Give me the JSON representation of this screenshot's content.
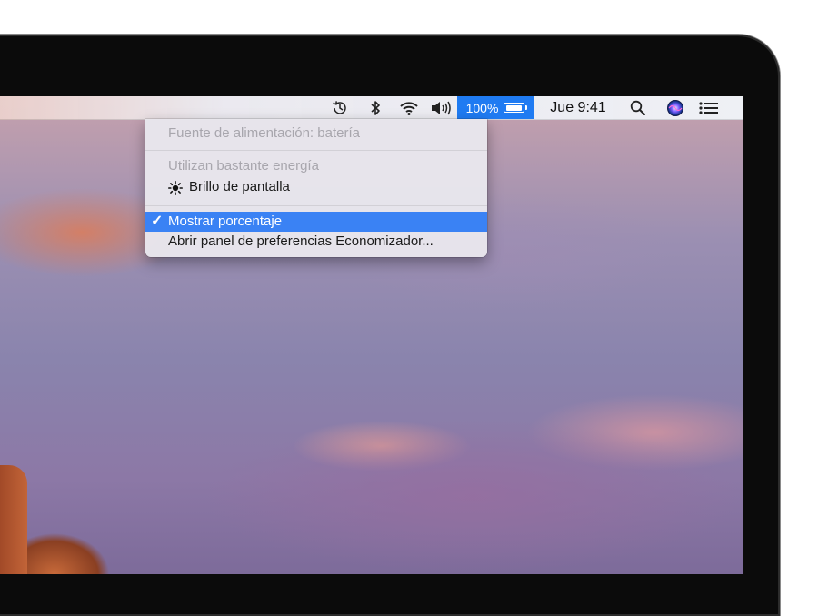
{
  "menubar": {
    "time": "Jue 9:41",
    "battery_percent": "100%",
    "battery_level": 1.0,
    "icons": [
      "time-machine-icon",
      "bluetooth-icon",
      "wifi-icon",
      "volume-icon",
      "battery-icon",
      "spotlight-icon",
      "siri-icon",
      "notification-center-icon"
    ]
  },
  "battery_menu": {
    "power_source": "Fuente de alimentación: batería",
    "heavy_usage_header": "Utilizan bastante energía",
    "heavy_app": "Brillo de pantalla",
    "show_percentage": "Mostrar porcentaje",
    "open_prefs": "Abrir panel de preferencias Economizador..."
  },
  "colors": {
    "highlight": "#3a82f4",
    "menubar_active": "#1f7bf2"
  }
}
